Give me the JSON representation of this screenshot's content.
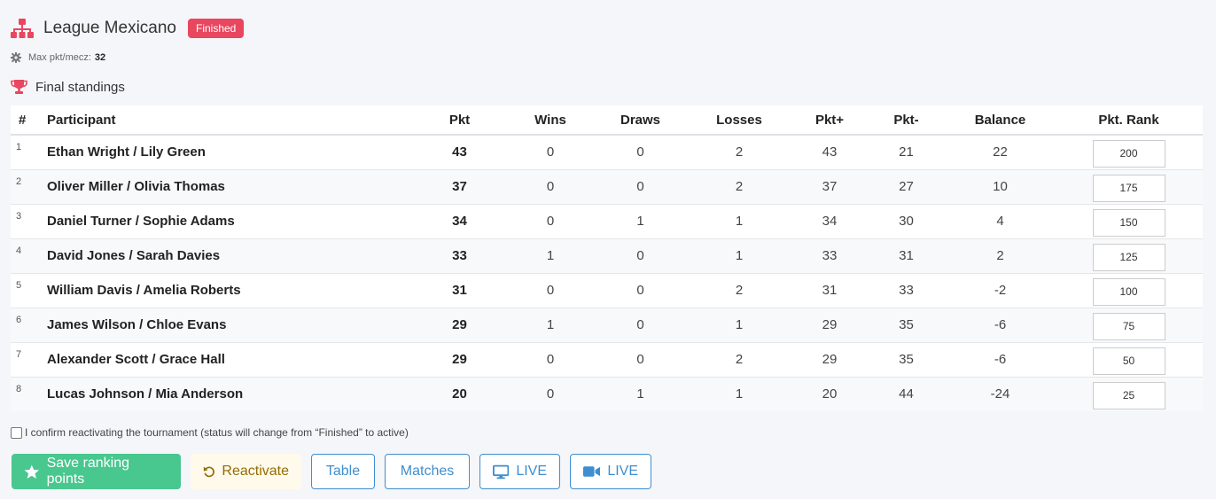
{
  "header": {
    "title": "League Mexicano",
    "status_badge": "Finished"
  },
  "settings": {
    "max_label": "Max pkt/mecz:",
    "max_value": "32"
  },
  "section": {
    "title": "Final standings"
  },
  "table": {
    "columns": [
      "#",
      "Participant",
      "Pkt",
      "Wins",
      "Draws",
      "Losses",
      "Pkt+",
      "Pkt-",
      "Balance",
      "Pkt. Rank"
    ],
    "rows": [
      {
        "pos": "1",
        "participant": "Ethan Wright / Lily Green",
        "pkt": "43",
        "wins": "0",
        "draws": "0",
        "losses": "2",
        "pkt_plus": "43",
        "pkt_minus": "21",
        "balance": "22",
        "rank_points": "200"
      },
      {
        "pos": "2",
        "participant": "Oliver Miller / Olivia Thomas",
        "pkt": "37",
        "wins": "0",
        "draws": "0",
        "losses": "2",
        "pkt_plus": "37",
        "pkt_minus": "27",
        "balance": "10",
        "rank_points": "175"
      },
      {
        "pos": "3",
        "participant": "Daniel Turner / Sophie Adams",
        "pkt": "34",
        "wins": "0",
        "draws": "1",
        "losses": "1",
        "pkt_plus": "34",
        "pkt_minus": "30",
        "balance": "4",
        "rank_points": "150"
      },
      {
        "pos": "4",
        "participant": "David Jones / Sarah Davies",
        "pkt": "33",
        "wins": "1",
        "draws": "0",
        "losses": "1",
        "pkt_plus": "33",
        "pkt_minus": "31",
        "balance": "2",
        "rank_points": "125"
      },
      {
        "pos": "5",
        "participant": "William Davis / Amelia Roberts",
        "pkt": "31",
        "wins": "0",
        "draws": "0",
        "losses": "2",
        "pkt_plus": "31",
        "pkt_minus": "33",
        "balance": "-2",
        "rank_points": "100"
      },
      {
        "pos": "6",
        "participant": "James Wilson / Chloe Evans",
        "pkt": "29",
        "wins": "1",
        "draws": "0",
        "losses": "1",
        "pkt_plus": "29",
        "pkt_minus": "35",
        "balance": "-6",
        "rank_points": "75"
      },
      {
        "pos": "7",
        "participant": "Alexander Scott / Grace Hall",
        "pkt": "29",
        "wins": "0",
        "draws": "0",
        "losses": "2",
        "pkt_plus": "29",
        "pkt_minus": "35",
        "balance": "-6",
        "rank_points": "50"
      },
      {
        "pos": "8",
        "participant": "Lucas Johnson / Mia Anderson",
        "pkt": "20",
        "wins": "0",
        "draws": "1",
        "losses": "1",
        "pkt_plus": "20",
        "pkt_minus": "44",
        "balance": "-24",
        "rank_points": "25"
      }
    ]
  },
  "confirm": {
    "label": "I confirm reactivating the tournament (status will change from “Finished” to active)",
    "checked": false
  },
  "buttons": {
    "save": "Save ranking points",
    "reactivate": "Reactivate",
    "table": "Table",
    "matches": "Matches",
    "live_screen": "LIVE",
    "live_video": "LIVE"
  },
  "icons": {
    "header": "sitemap-icon",
    "settings": "gear-icon",
    "section": "trophy-icon",
    "save": "star-icon",
    "reactivate": "undo-icon",
    "live_screen": "desktop-icon",
    "live_video": "video-icon"
  },
  "colors": {
    "accent_red": "#e8475f",
    "success": "#48c78e",
    "warning_text": "#946c00",
    "warning_bg": "#fffaeb",
    "info": "#3e8ed0"
  }
}
